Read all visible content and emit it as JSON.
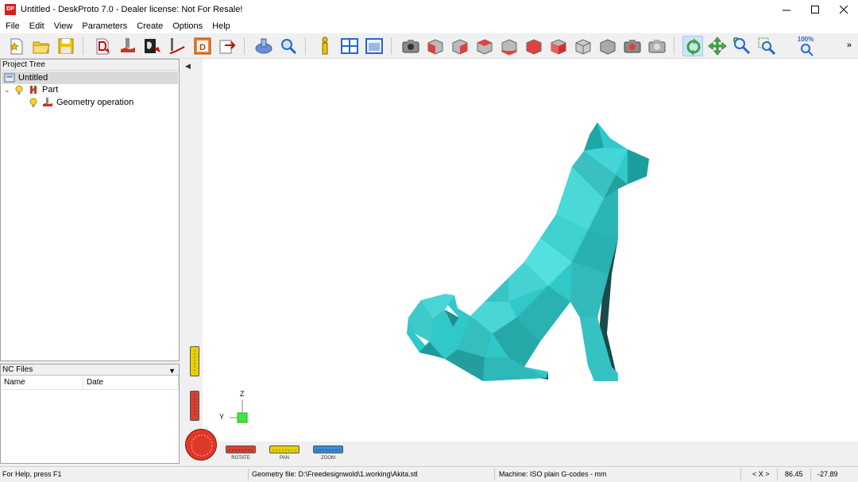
{
  "window": {
    "title": "Untitled - DeskProto 7.0 - Dealer license: Not For Resale!",
    "app_icon": "DP",
    "minimize_icon": "minimize-icon",
    "maximize_icon": "maximize-icon",
    "close_icon": "close-icon"
  },
  "menu": [
    "File",
    "Edit",
    "View",
    "Parameters",
    "Create",
    "Options",
    "Help"
  ],
  "toolbar": {
    "zoom_label": "100%",
    "more_label": "»",
    "icons": [
      "new-project-icon",
      "open-icon",
      "save-icon",
      "import-geometry-icon",
      "add-operation-icon",
      "bitmap-operation-icon",
      "vector-operation-icon",
      "drawing-icon",
      "export-icon",
      "simulate-icon",
      "preview-icon",
      "info-icon",
      "layout-icon",
      "window-icon",
      "camera-icon",
      "view-front-icon",
      "view-back-icon",
      "view-left-icon",
      "view-right-icon",
      "view-top-icon",
      "view-bottom-icon",
      "view-iso-icon",
      "view-3d-icon",
      "render-icon",
      "print-icon",
      "rotate-icon",
      "pan-icon",
      "zoom-in-icon",
      "zoom-window-icon",
      "zoom-100-icon"
    ],
    "active": "rotate-icon"
  },
  "project_tree": {
    "title": "Project Tree",
    "root": "Untitled",
    "part": "Part",
    "operation": "Geometry operation"
  },
  "nc_files": {
    "title": "NC Files",
    "columns": [
      "Name",
      "Date"
    ]
  },
  "viewport": {
    "model_color": "#30c8c8",
    "axis_z": "Z",
    "axis_y": "Y",
    "gauges": {
      "rotate": "ROTATE",
      "pan": "PAN",
      "zoom": "ZOOM"
    }
  },
  "status": {
    "help": "For Help, press F1",
    "geometry": "Geometry file: D:\\Freedesignwold\\1.working\\Akita.stl",
    "machine": "Machine: ISO plain G-codes - mm",
    "coord_label": "< X >",
    "x": "86.45",
    "y": "-27.89"
  }
}
